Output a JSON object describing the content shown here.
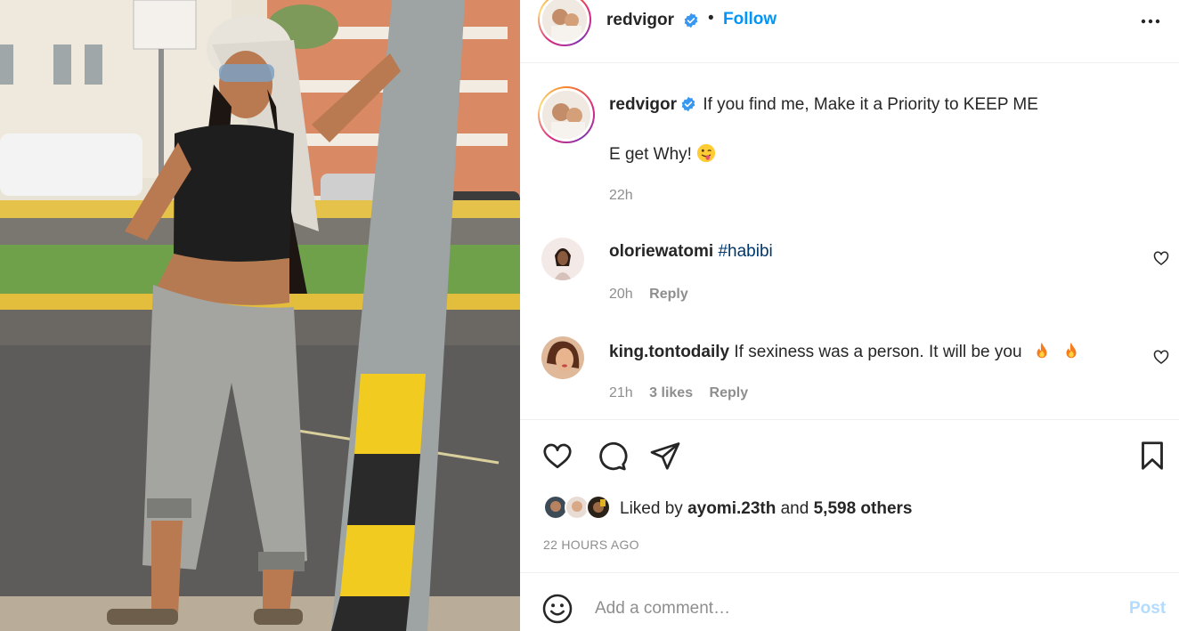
{
  "post": {
    "author": "redvigor",
    "follow_label": "Follow",
    "separator": "•",
    "more_icon": "more-horizontal-icon"
  },
  "caption": {
    "author": "redvigor",
    "text": "If you find me, Make it a Priority to KEEP ME",
    "line2": "E get Why!",
    "emoji": "winking-tongue-emoji",
    "time": "22h"
  },
  "comments": [
    {
      "author": "oloriewatomi",
      "text": "#habibi",
      "time": "20h",
      "reply_label": "Reply"
    },
    {
      "author": "king.tontodaily",
      "text": "If sexiness was a person. It will be you",
      "emoji": "fire-emoji",
      "time": "21h",
      "likes": "3 likes",
      "reply_label": "Reply"
    }
  ],
  "actions": {
    "like_icon": "heart-icon",
    "comment_icon": "comment-icon",
    "share_icon": "send-icon",
    "save_icon": "bookmark-icon"
  },
  "likes": {
    "prefix": "Liked by",
    "user": "ayomi.23th",
    "conjunction": "and",
    "others": "5,598 others"
  },
  "timestamp": "22 HOURS AGO",
  "comment_box": {
    "placeholder": "Add a comment…",
    "post_label": "Post"
  },
  "colors": {
    "accent": "#0095f6",
    "post_disabled": "#b3dbff",
    "verified": "#3897f0",
    "muted": "#8e8e8e"
  }
}
